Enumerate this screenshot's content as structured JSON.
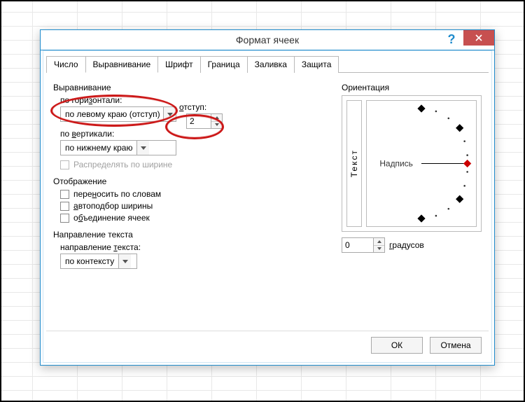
{
  "window": {
    "title": "Формат ячеек"
  },
  "tabs": {
    "items": [
      {
        "label": "Число"
      },
      {
        "label": "Выравнивание"
      },
      {
        "label": "Шрифт"
      },
      {
        "label": "Граница"
      },
      {
        "label": "Заливка"
      },
      {
        "label": "Защита"
      }
    ],
    "active_index": 1
  },
  "alignment": {
    "group_label": "Выравнивание",
    "horizontal_label": "по горизонтали:",
    "horizontal_value": "по левому краю (отступ)",
    "indent_label": "отступ:",
    "indent_value": "2",
    "vertical_label": "по вертикали:",
    "vertical_value": "по нижнему краю",
    "justify_distributed_label": "Распределять по ширине"
  },
  "display": {
    "group_label": "Отображение",
    "wrap_label": "переносить по словам",
    "shrink_label": "автоподбор ширины",
    "merge_label": "объединение ячеек"
  },
  "text_direction": {
    "group_label": "Направление текста",
    "label": "направление текста:",
    "value": "по контексту"
  },
  "orientation": {
    "group_label": "Ориентация",
    "vertical_text": "Текст",
    "dial_label": "Надпись",
    "degrees_value": "0",
    "degrees_label": "градусов"
  },
  "footer": {
    "ok": "ОК",
    "cancel": "Отмена"
  }
}
